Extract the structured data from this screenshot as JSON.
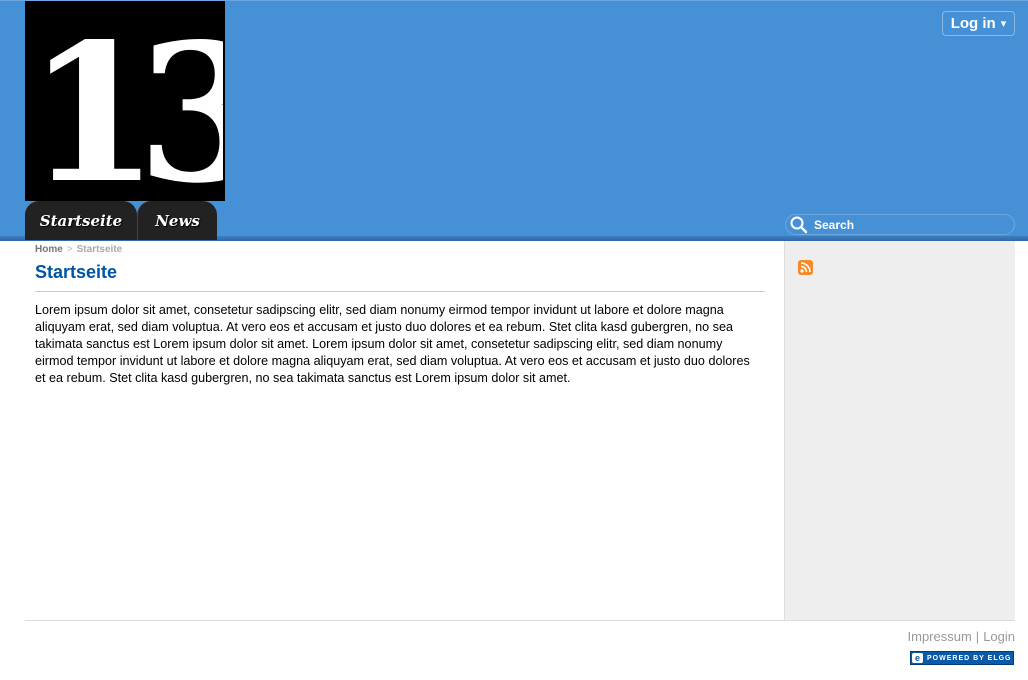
{
  "header": {
    "logo_text": "13",
    "login_label": "Log in",
    "login_caret": "▾",
    "search_placeholder": "Search"
  },
  "nav": {
    "tabs": [
      {
        "label": "Startseite"
      },
      {
        "label": "News"
      }
    ]
  },
  "breadcrumb": {
    "home": "Home",
    "separator": ">",
    "current": "Startseite"
  },
  "main": {
    "title": "Startseite",
    "body": "Lorem ipsum dolor sit amet, consetetur sadipscing elitr, sed diam nonumy eirmod tempor invidunt ut labore et dolore magna aliquyam erat, sed diam voluptua. At vero eos et accusam et justo duo dolores et ea rebum. Stet clita kasd gubergren, no sea takimata sanctus est Lorem ipsum dolor sit amet. Lorem ipsum dolor sit amet, consetetur sadipscing elitr, sed diam nonumy eirmod tempor invidunt ut labore et dolore magna aliquyam erat, sed diam voluptua. At vero eos et accusam et justo duo dolores et ea rebum. Stet clita kasd gubergren, no sea takimata sanctus est Lorem ipsum dolor sit amet."
  },
  "sidebar": {
    "rss_icon": "rss-icon"
  },
  "footer": {
    "links": [
      {
        "label": "Impressum"
      },
      {
        "label": "Login"
      }
    ],
    "separator": "|",
    "badge_text": "POWERED BY ELGG"
  },
  "colors": {
    "header_bg": "#4690d6",
    "title": "#0054a7",
    "tab_bg": "#222222",
    "sidebar_bg": "#eeeeee",
    "rss": "#f48a2a"
  }
}
